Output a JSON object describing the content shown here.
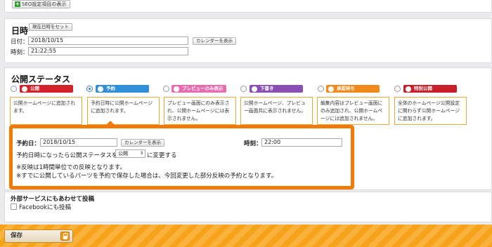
{
  "seo": {
    "button_label": "SEO設定項目の表示"
  },
  "datetime": {
    "title": "日時",
    "set_now_label": "現在日時をセット",
    "date_label": "日付：",
    "date_value": "2018/10/15",
    "calendar_label": "カレンダーを表示",
    "time_label": "時刻：",
    "time_value": "21:22:55"
  },
  "status": {
    "title": "公開ステータス",
    "selected": "予約",
    "options": [
      {
        "label": "公開",
        "color": "#d2232a",
        "desc": "公開ホームページに追加されます。"
      },
      {
        "label": "予約",
        "color": "#2f8fd8",
        "desc": "予約日時に公開ホームページに追加されます。"
      },
      {
        "label": "プレビューのみ表示",
        "color": "#e96bb0",
        "desc": "プレビュー画面にのみ表示され、公開ホームページには表示されません。"
      },
      {
        "label": "下書き",
        "color": "#8a4fb5",
        "desc": "公開ホームページ、プレビュー画面共に表示されません。"
      },
      {
        "label": "承認待ち",
        "color": "#f08a1c",
        "desc": "編集内容はプレビュー画面にのみ追加され、公開ホームページには追加されません。"
      },
      {
        "label": "特別公開",
        "color": "#c8202a",
        "desc": "全体のホームページ公開設定に関わらず公開ホームページに追加されます。"
      }
    ]
  },
  "reserve": {
    "date_label": "予約日：",
    "date_value": "2018/10/15",
    "calendar_label": "カレンダーを表示",
    "time_label": "時刻：",
    "time_value": "22:00",
    "change_prefix": "予約日時になったら公開ステータスを",
    "status_select": "公開",
    "change_suffix": "に変更する",
    "note1": "※反映は1時間単位での反映となります。",
    "note2": "※すでに公開しているパーツを予約で保存した場合は、今回変更した部分反映の予約となります。"
  },
  "external": {
    "title": "外部サービスにもあわせて投稿",
    "facebook_label": "Facebookにも投稿"
  },
  "save": {
    "label": "保存"
  }
}
